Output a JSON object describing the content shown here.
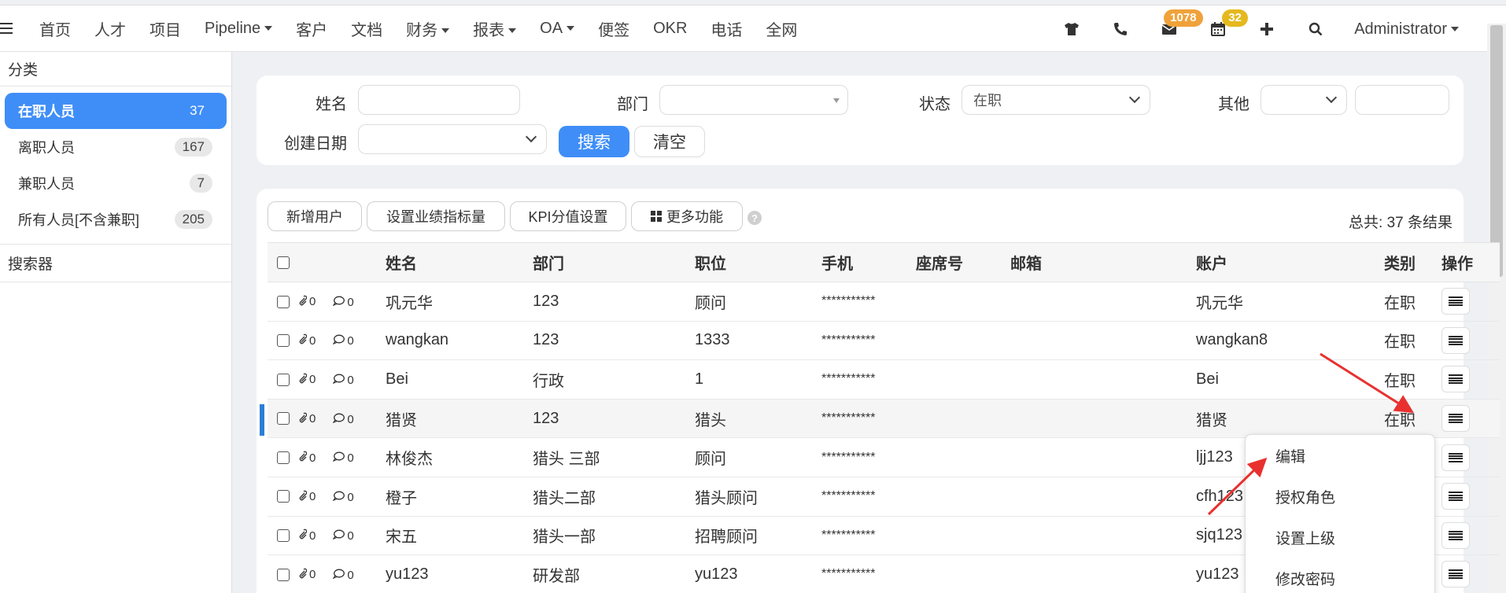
{
  "nav": {
    "items": [
      {
        "label": "首页",
        "dropdown": false
      },
      {
        "label": "人才",
        "dropdown": false
      },
      {
        "label": "项目",
        "dropdown": false
      },
      {
        "label": "Pipeline",
        "dropdown": true
      },
      {
        "label": "客户",
        "dropdown": false
      },
      {
        "label": "文档",
        "dropdown": false
      },
      {
        "label": "财务",
        "dropdown": true
      },
      {
        "label": "报表",
        "dropdown": true
      },
      {
        "label": "OA",
        "dropdown": true
      },
      {
        "label": "便签",
        "dropdown": false
      },
      {
        "label": "OKR",
        "dropdown": false
      },
      {
        "label": "电话",
        "dropdown": false
      },
      {
        "label": "全网",
        "dropdown": false
      }
    ],
    "mail_badge": "1078",
    "calendar_badge": "32",
    "user": "Administrator"
  },
  "sidebar": {
    "category_title": "分类",
    "items": [
      {
        "label": "在职人员",
        "count": "37",
        "active": true
      },
      {
        "label": "离职人员",
        "count": "167",
        "active": false
      },
      {
        "label": "兼职人员",
        "count": "7",
        "active": false
      },
      {
        "label": "所有人员[不含兼职]",
        "count": "205",
        "active": false
      }
    ],
    "search_title": "搜索器"
  },
  "filter": {
    "name_label": "姓名",
    "name_value": "",
    "dept_label": "部门",
    "dept_value": "",
    "status_label": "状态",
    "status_value": "在职",
    "other_label": "其他",
    "other_value": "",
    "created_label": "创建日期",
    "created_value": "",
    "search_button": "搜索",
    "clear_button": "清空"
  },
  "toolbar": {
    "add_user": "新增用户",
    "set_kpi": "设置业绩指标量",
    "kpi_score": "KPI分值设置",
    "more": "更多功能",
    "help": "?",
    "total": "总共: 37 条结果"
  },
  "table": {
    "headers": {
      "name": "姓名",
      "dept": "部门",
      "position": "职位",
      "phone": "手机",
      "seat": "座席号",
      "email": "邮箱",
      "account": "账户",
      "type": "类别",
      "action": "操作"
    },
    "rows": [
      {
        "attach": "0",
        "comments": "0",
        "name": "巩元华",
        "dept": "123",
        "position": "顾问",
        "phone": "***********",
        "seat": "",
        "email": "",
        "account": "巩元华",
        "type": "在职",
        "highlight": false
      },
      {
        "attach": "0",
        "comments": "0",
        "name": "wangkan",
        "dept": "123",
        "position": "1333",
        "phone": "***********",
        "seat": "",
        "email": "",
        "account": "wangkan8",
        "type": "在职",
        "highlight": false
      },
      {
        "attach": "0",
        "comments": "0",
        "name": "Bei",
        "dept": "行政",
        "position": "1",
        "phone": "***********",
        "seat": "",
        "email": "",
        "account": "Bei",
        "type": "在职",
        "highlight": false
      },
      {
        "attach": "0",
        "comments": "0",
        "name": "猎贤",
        "dept": "123",
        "position": "猎头",
        "phone": "***********",
        "seat": "",
        "email": "",
        "account": "猎贤",
        "type": "在职",
        "highlight": true
      },
      {
        "attach": "0",
        "comments": "0",
        "name": "林俊杰",
        "dept": "猎头 三部",
        "position": "顾问",
        "phone": "***********",
        "seat": "",
        "email": "",
        "account": "ljj123",
        "type": "",
        "highlight": false
      },
      {
        "attach": "0",
        "comments": "0",
        "name": "橙子",
        "dept": "猎头二部",
        "position": "猎头顾问",
        "phone": "***********",
        "seat": "",
        "email": "",
        "account": "cfh123",
        "type": "",
        "highlight": false
      },
      {
        "attach": "0",
        "comments": "0",
        "name": "宋五",
        "dept": "猎头一部",
        "position": "招聘顾问",
        "phone": "***********",
        "seat": "",
        "email": "",
        "account": "sjq123",
        "type": "",
        "highlight": false
      },
      {
        "attach": "0",
        "comments": "0",
        "name": "yu123",
        "dept": "研发部",
        "position": "yu123",
        "phone": "***********",
        "seat": "",
        "email": "",
        "account": "yu123",
        "type": "",
        "highlight": false
      }
    ]
  },
  "menu": {
    "items": [
      "编辑",
      "授权角色",
      "设置上级",
      "修改密码"
    ]
  },
  "colors": {
    "primary": "#3f8ef7",
    "badge_orange": "#f0a23a",
    "badge_yellow": "#e5b81e",
    "annotation_red": "#e8312f"
  }
}
